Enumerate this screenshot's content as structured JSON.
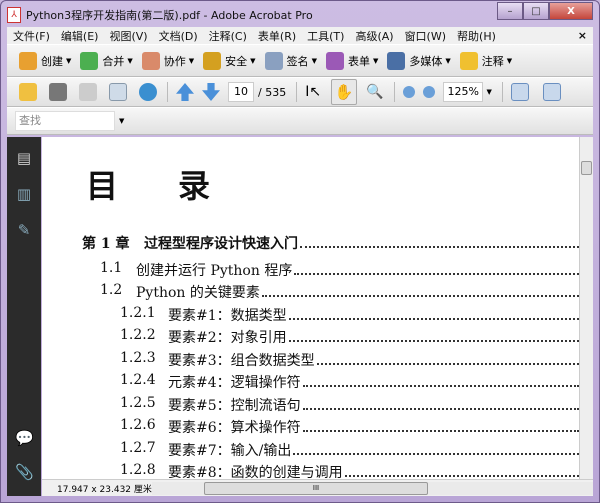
{
  "window": {
    "title": "Python3程序开发指南(第二版).pdf - Adobe Acrobat Pro",
    "min": "–",
    "max": "□",
    "close": "X"
  },
  "menu": [
    "文件(F)",
    "编辑(E)",
    "视图(V)",
    "文档(D)",
    "注释(C)",
    "表单(R)",
    "工具(T)",
    "高级(A)",
    "窗口(W)",
    "帮助(H)"
  ],
  "menu_close": "×",
  "toolbar1": [
    {
      "label": "创建",
      "icon": "create-icon",
      "color": "#e8a030"
    },
    {
      "label": "合并",
      "icon": "combine-icon",
      "color": "#4caf50"
    },
    {
      "label": "协作",
      "icon": "collaborate-icon",
      "color": "#d98a6a"
    },
    {
      "label": "安全",
      "icon": "lock-icon",
      "color": "#d4a020"
    },
    {
      "label": "签名",
      "icon": "pen-icon",
      "color": "#8aa0c0"
    },
    {
      "label": "表单",
      "icon": "form-icon",
      "color": "#9b59b6"
    },
    {
      "label": "多媒体",
      "icon": "multimedia-icon",
      "color": "#4a6fa5"
    },
    {
      "label": "注释",
      "icon": "comment-icon",
      "color": "#f0c030"
    }
  ],
  "toolbar2": {
    "page_current": "10",
    "page_total": "/ 535",
    "zoom": "125%"
  },
  "find": {
    "placeholder": "查找"
  },
  "document": {
    "title": "目录",
    "entries": [
      {
        "num": "第 1 章",
        "text": "过程型程序设计快速入门",
        "level": 0
      },
      {
        "num": "1.1",
        "text": "创建并运行 Python 程序",
        "level": 1
      },
      {
        "num": "1.2",
        "text": "Python 的关键要素",
        "level": 1
      },
      {
        "num": "1.2.1",
        "text": "要素#1：数据类型",
        "level": 2
      },
      {
        "num": "1.2.2",
        "text": "要素#2：对象引用",
        "level": 2
      },
      {
        "num": "1.2.3",
        "text": "要素#3：组合数据类型",
        "level": 2
      },
      {
        "num": "1.2.4",
        "text": "元素#4：逻辑操作符",
        "level": 2
      },
      {
        "num": "1.2.5",
        "text": "要素#5：控制流语句",
        "level": 2
      },
      {
        "num": "1.2.6",
        "text": "要素#6：算术操作符",
        "level": 2
      },
      {
        "num": "1.2.7",
        "text": "要素#7：输入/输出",
        "level": 2
      },
      {
        "num": "1.2.8",
        "text": "要素#8：函数的创建与调用",
        "level": 2
      }
    ]
  },
  "status": {
    "dimensions": "17.947 x 23.432 厘米"
  }
}
